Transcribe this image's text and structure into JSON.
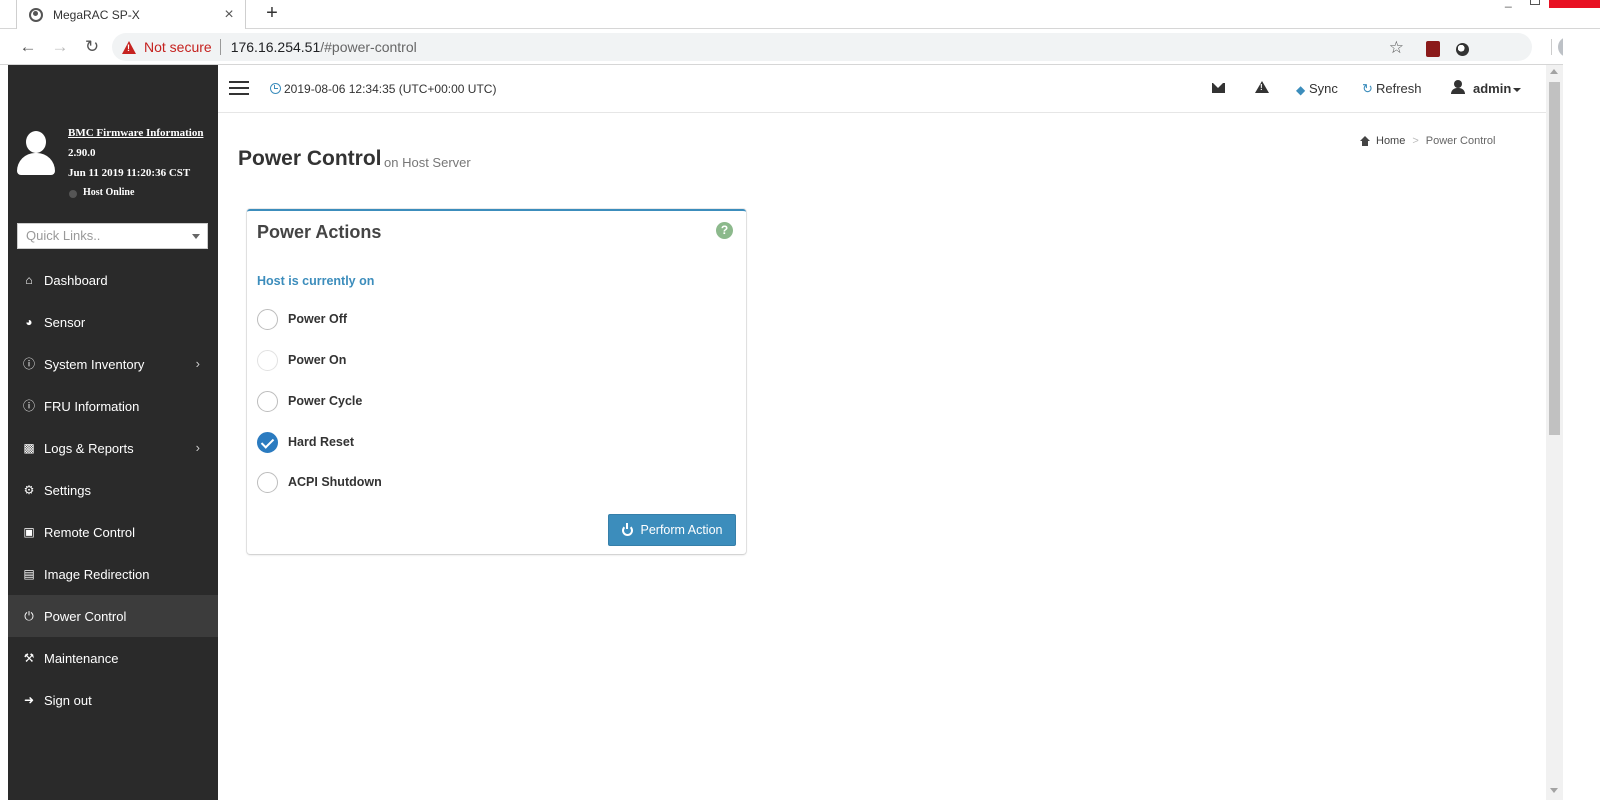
{
  "browser": {
    "tab_title": "MegaRAC SP-X",
    "tab_close": "×",
    "new_tab": "+",
    "not_secure": "Not secure",
    "url_host": "176.16.254.51",
    "url_path": "/#power-control"
  },
  "sidebar": {
    "fw_link": "BMC Firmware Information",
    "fw_version": "2.90.0",
    "fw_date": "Jun 11 2019 11:20:36 CST",
    "host_status": "Host Online",
    "quick_links_placeholder": "Quick Links..",
    "items": [
      {
        "label": "Dashboard",
        "icon": "home-icon"
      },
      {
        "label": "Sensor",
        "icon": "gauge-icon"
      },
      {
        "label": "System Inventory",
        "icon": "info-icon",
        "has_submenu": true
      },
      {
        "label": "FRU Information",
        "icon": "info-icon"
      },
      {
        "label": "Logs & Reports",
        "icon": "bar-chart-icon",
        "has_submenu": true
      },
      {
        "label": "Settings",
        "icon": "gear-icon"
      },
      {
        "label": "Remote Control",
        "icon": "monitor-icon"
      },
      {
        "label": "Image Redirection",
        "icon": "hdd-icon"
      },
      {
        "label": "Power Control",
        "icon": "power-icon",
        "active": true
      },
      {
        "label": "Maintenance",
        "icon": "wrench-icon"
      },
      {
        "label": "Sign out",
        "icon": "sign-out-icon"
      }
    ]
  },
  "header": {
    "datetime": "2019-08-06 12:34:35 (UTC+00:00 UTC)",
    "sync_label": "Sync",
    "refresh_label": "Refresh",
    "user_label": "admin"
  },
  "page": {
    "title": "Power Control",
    "subtitle": "on Host Server",
    "breadcrumb_home": "Home",
    "breadcrumb_sep": ">",
    "breadcrumb_current": "Power Control"
  },
  "panel": {
    "title": "Power Actions",
    "help": "?",
    "host_state": "Host is currently on",
    "options": [
      {
        "label": "Power Off",
        "checked": false
      },
      {
        "label": "Power On",
        "checked": false
      },
      {
        "label": "Power Cycle",
        "checked": false
      },
      {
        "label": "Hard Reset",
        "checked": true
      },
      {
        "label": "ACPI Shutdown",
        "checked": false
      }
    ],
    "perform_label": "Perform Action"
  },
  "colors": {
    "accent": "#3c8dbc",
    "sidebar_bg": "#2a2a2a",
    "sidebar_active": "#3c3c3c",
    "checked_radio": "#2b7bc0",
    "not_secure": "#c5221f"
  }
}
